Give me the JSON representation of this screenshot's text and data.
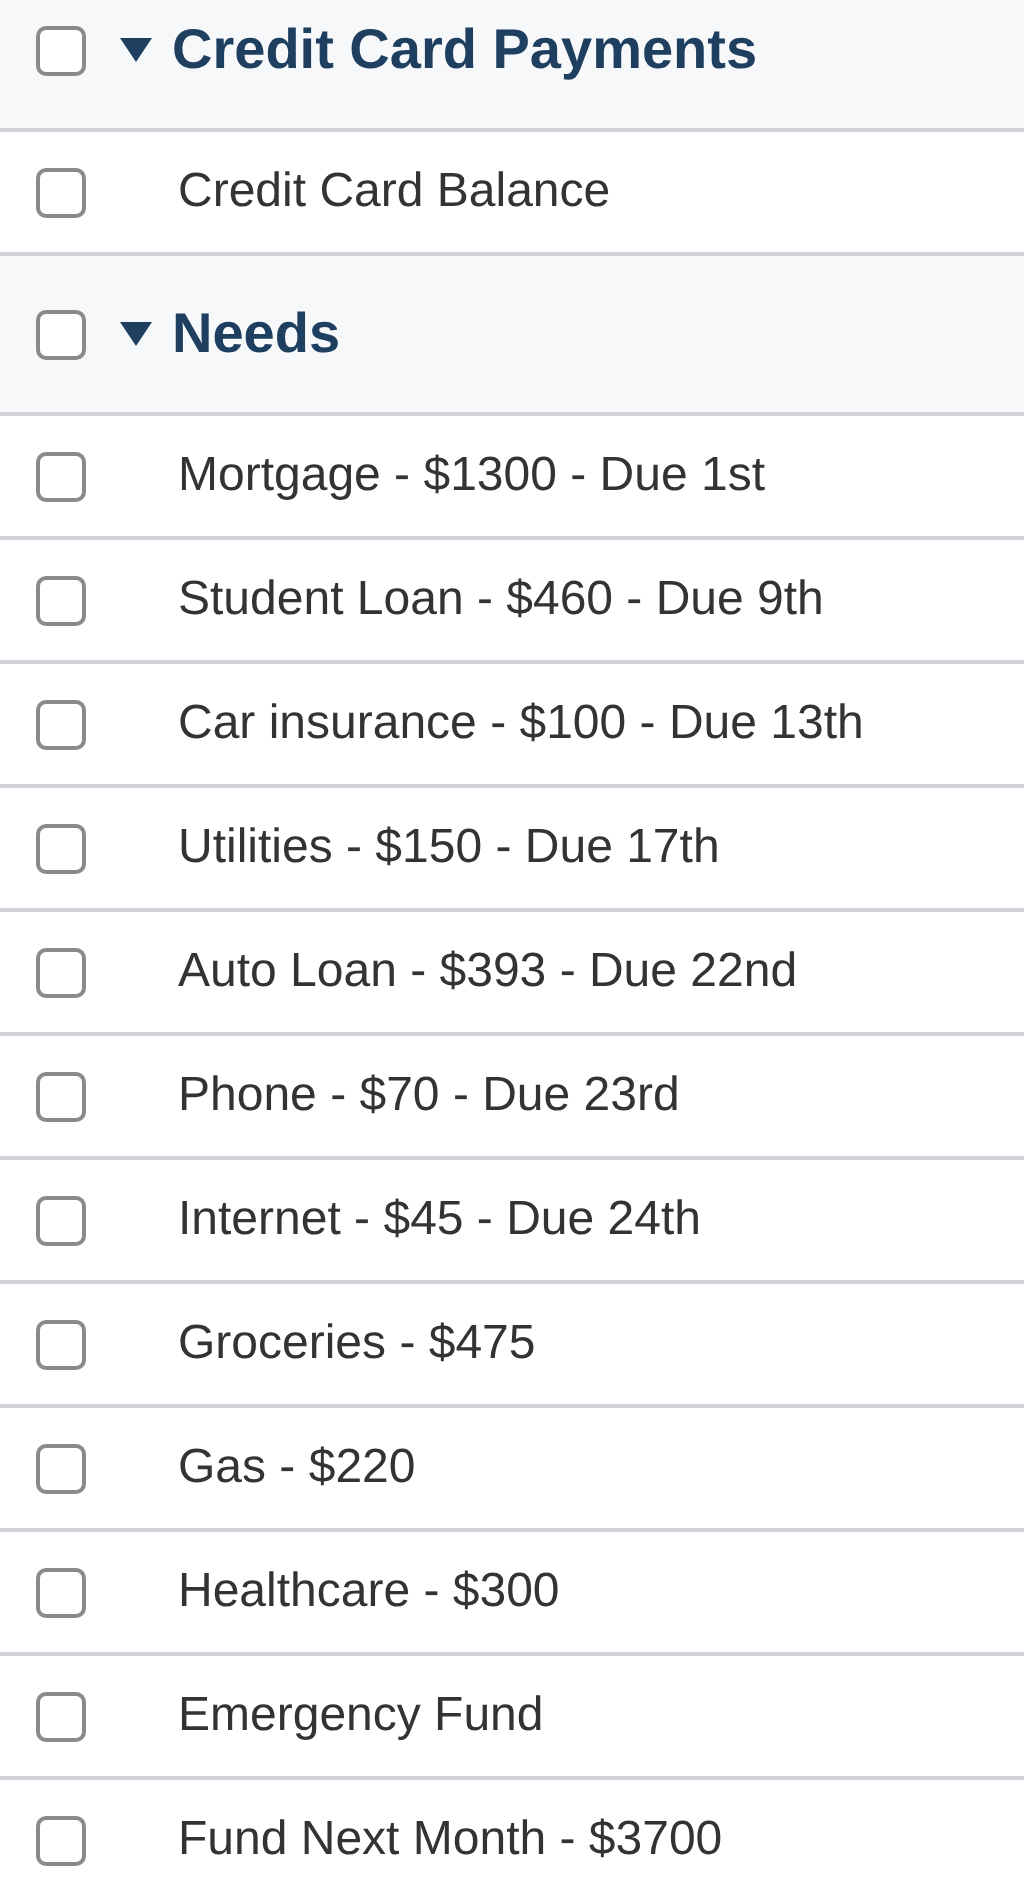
{
  "groups": [
    {
      "title": "Credit Card Payments",
      "expanded": true,
      "checked": false,
      "items": [
        {
          "label": "Credit Card Balance",
          "checked": false
        }
      ]
    },
    {
      "title": "Needs",
      "expanded": true,
      "checked": false,
      "items": [
        {
          "label": "Mortgage - $1300 - Due 1st",
          "checked": false
        },
        {
          "label": "Student Loan - $460 - Due 9th",
          "checked": false
        },
        {
          "label": "Car insurance - $100 - Due 13th",
          "checked": false
        },
        {
          "label": "Utilities - $150 - Due 17th",
          "checked": false
        },
        {
          "label": "Auto Loan - $393 - Due 22nd",
          "checked": false
        },
        {
          "label": "Phone - $70 - Due 23rd",
          "checked": false
        },
        {
          "label": "Internet - $45 - Due 24th",
          "checked": false
        },
        {
          "label": "Groceries - $475",
          "checked": false
        },
        {
          "label": "Gas - $220",
          "checked": false
        },
        {
          "label": "Healthcare - $300",
          "checked": false
        },
        {
          "label": "Emergency Fund",
          "checked": false
        },
        {
          "label": "Fund Next Month - $3700",
          "checked": false
        }
      ]
    }
  ]
}
